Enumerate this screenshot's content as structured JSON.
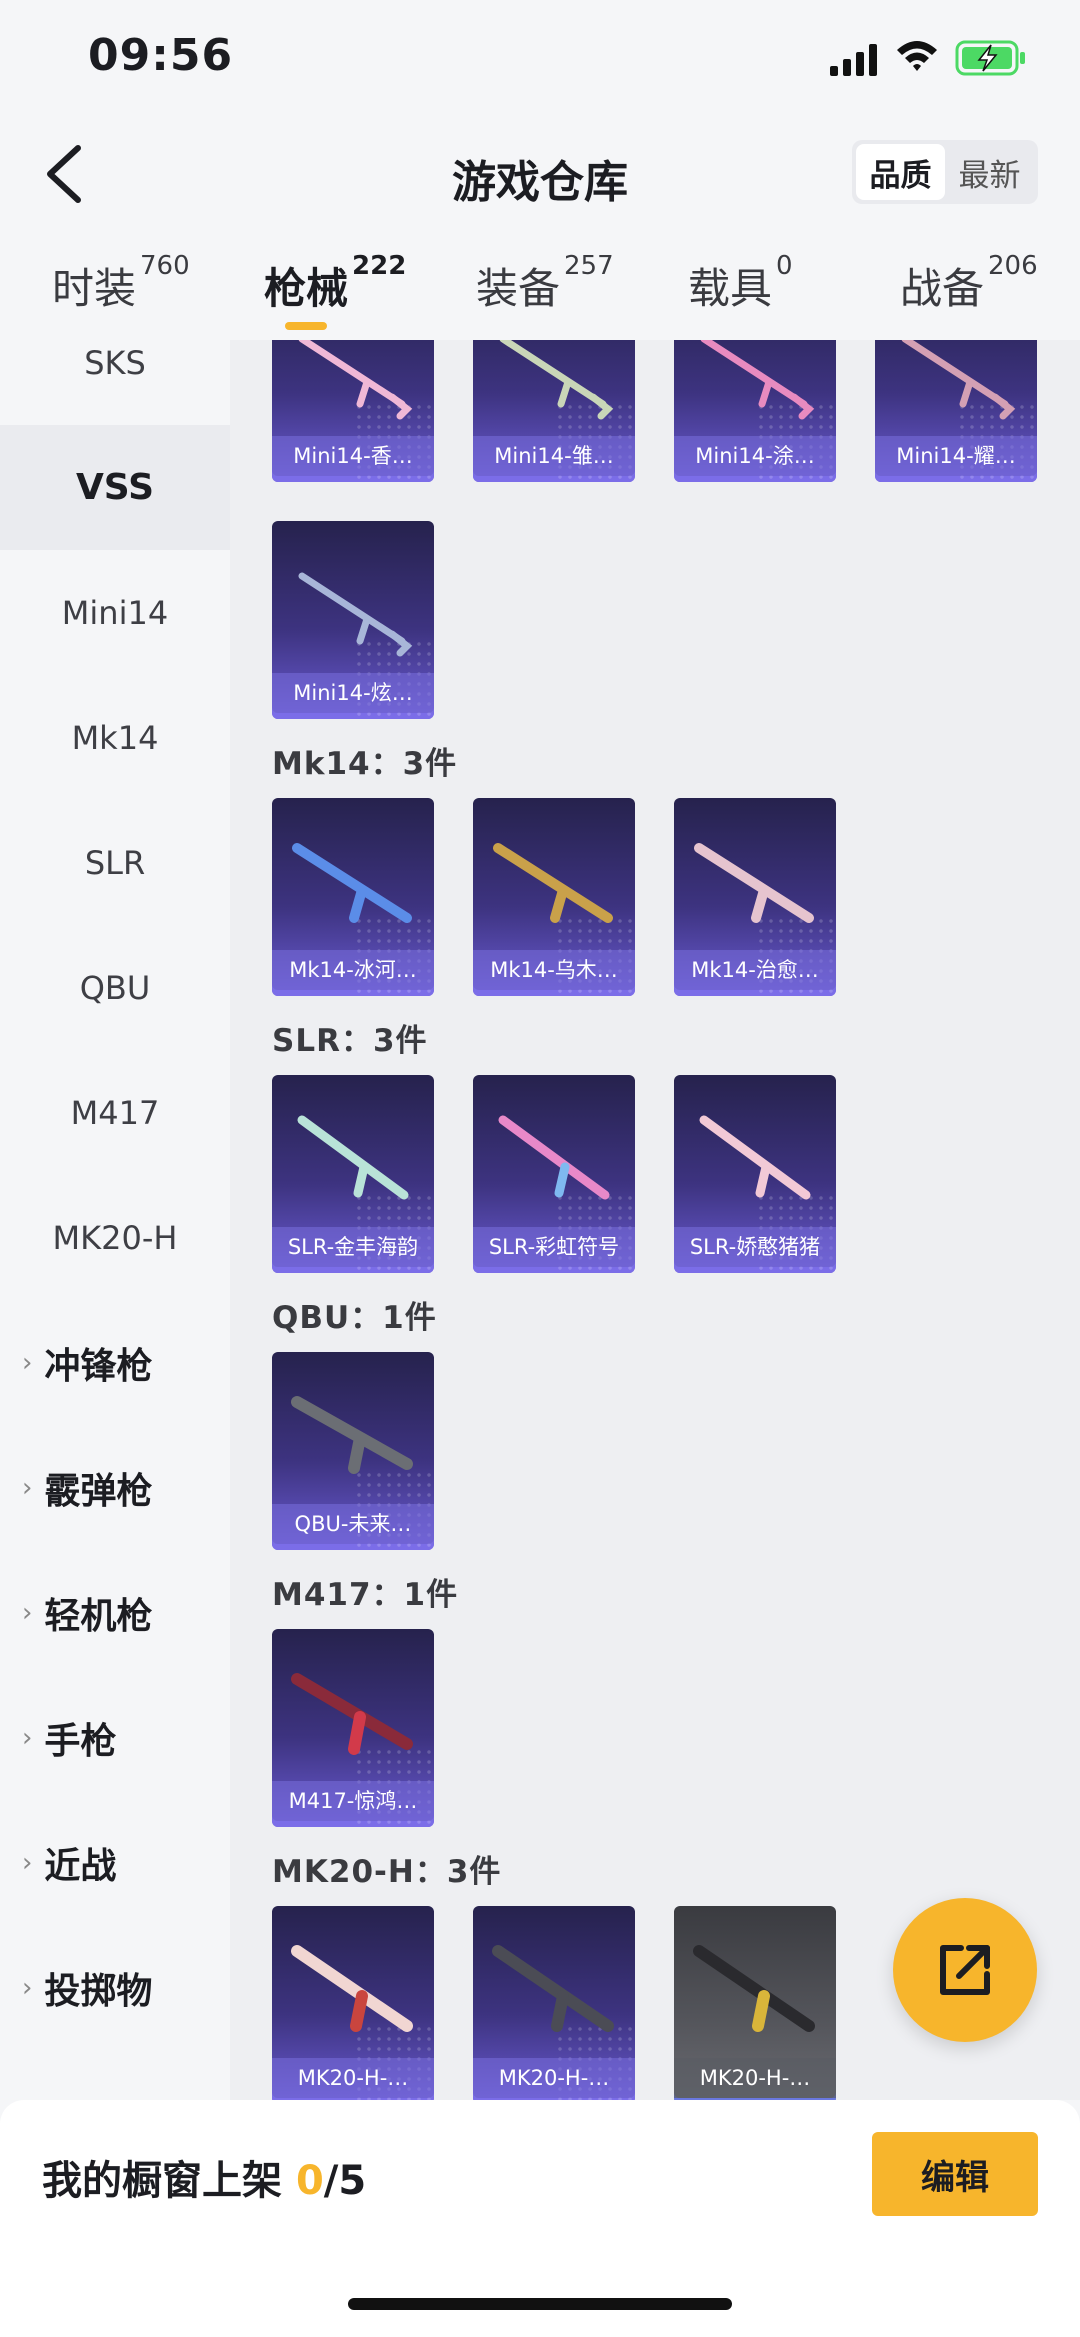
{
  "status_bar": {
    "time": "09:56"
  },
  "header": {
    "title": "游戏仓库",
    "sort_options": [
      "品质",
      "最新"
    ],
    "sort_selected": "品质"
  },
  "tabs": [
    {
      "label": "时装",
      "count": "760"
    },
    {
      "label": "枪械",
      "count": "222"
    },
    {
      "label": "装备",
      "count": "257"
    },
    {
      "label": "载具",
      "count": "0"
    },
    {
      "label": "战备",
      "count": "206"
    }
  ],
  "sidebar": {
    "items": [
      "SKS",
      "VSS",
      "Mini14",
      "Mk14",
      "SLR",
      "QBU",
      "M417",
      "MK20-H"
    ],
    "active": "VSS",
    "categories": [
      "冲锋枪",
      "霰弹枪",
      "轻机枪",
      "手枪",
      "近战",
      "投掷物"
    ]
  },
  "groups": [
    {
      "title": "",
      "items": [
        "Mini14-香…",
        "Mini14-雏…",
        "Mini14-涂…",
        "Mini14-耀…",
        "Mini14-炫…"
      ]
    },
    {
      "title": "Mk14：3件",
      "items": [
        "Mk14-冰河…",
        "Mk14-乌木…",
        "Mk14-治愈…"
      ]
    },
    {
      "title": "SLR：3件",
      "items": [
        "SLR-金丰海韵",
        "SLR-彩虹符号",
        "SLR-娇憨猪猪"
      ]
    },
    {
      "title": "QBU：1件",
      "items": [
        "QBU-未来…"
      ]
    },
    {
      "title": "M417：1件",
      "items": [
        "M417-惊鸿…"
      ]
    },
    {
      "title": "MK20-H：3件",
      "items": [
        "MK20-H-…",
        "MK20-H-…",
        "MK20-H-…"
      ]
    }
  ],
  "footer": {
    "label": "我的橱窗上架 ",
    "current": "0",
    "total": "/5",
    "edit_label": "编辑"
  },
  "colors": {
    "accent": "#f7b52c",
    "card_purple": "#3d3380"
  }
}
